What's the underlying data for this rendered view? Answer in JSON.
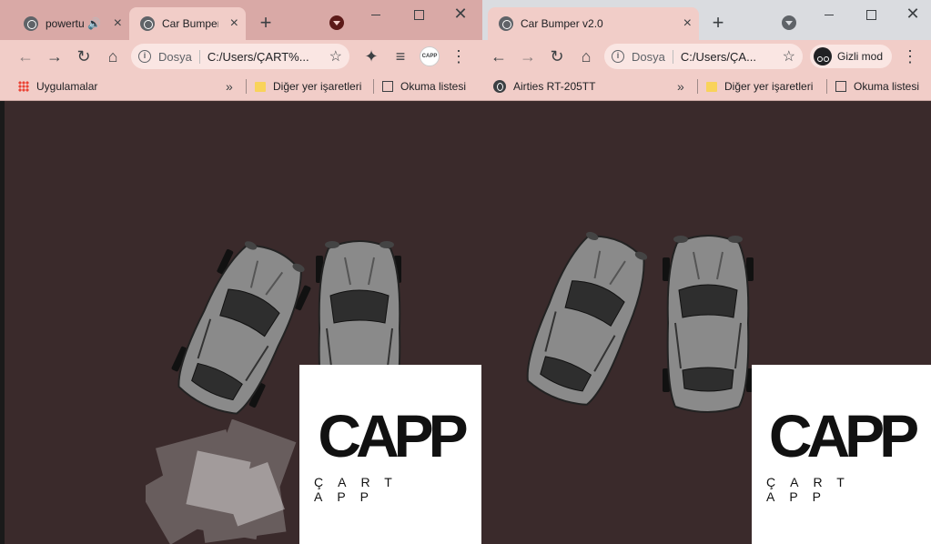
{
  "left_window": {
    "tabs": [
      {
        "title": "powertu",
        "muted_icon": "speaker-icon",
        "active": false
      },
      {
        "title": "Car Bumper",
        "active": true
      }
    ],
    "new_tab": "+",
    "url_scheme": "Dosya",
    "url": "C:/Users/ÇART%...",
    "bookmarks": {
      "apps": "Uygulamalar",
      "more": "»",
      "other": "Diğer yer işaretleri",
      "reading_list": "Okuma listesi"
    },
    "logo": {
      "mark": "CAPP",
      "sub": "ÇART APP"
    }
  },
  "right_window": {
    "tabs": [
      {
        "title": "Car Bumper v2.0",
        "active": true
      }
    ],
    "new_tab": "+",
    "url_scheme": "Dosya",
    "url": "C:/Users/ÇA...",
    "incognito_label": "Gizli mod",
    "bookmarks": {
      "airties": "Airties RT-205TT",
      "more": "»",
      "other": "Diğer yer işaretleri",
      "reading_list": "Okuma listesi"
    },
    "logo": {
      "mark": "CAPP",
      "sub": "ÇART APP"
    }
  },
  "colors": {
    "game_bg": "#3a2a2b",
    "left_tabstrip": "#d9a9a6",
    "toolbar": "#f1cdc8",
    "car_body": "#8a8a8a",
    "car_glass": "#2e2e2e"
  }
}
